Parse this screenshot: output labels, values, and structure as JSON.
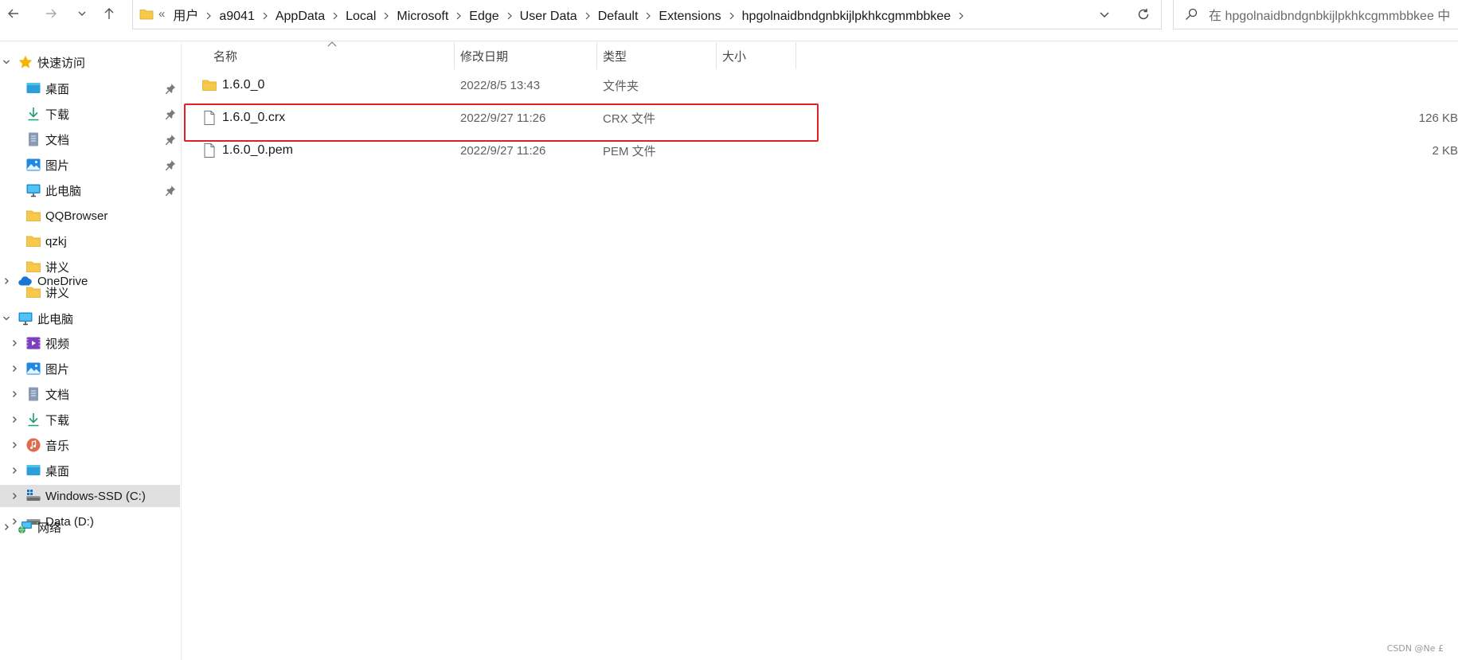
{
  "toolbar": {
    "back_icon": "arrow-left-icon",
    "forward_icon": "arrow-right-icon",
    "recent_icon": "chevron-down-icon",
    "up_icon": "arrow-up-icon"
  },
  "address": {
    "overflow": "«",
    "crumbs": [
      "用户",
      "a9041",
      "AppData",
      "Local",
      "Microsoft",
      "Edge",
      "User Data",
      "Default",
      "Extensions",
      "hpgolnaidbndgnbkijlpkhkcgmmbbkee"
    ]
  },
  "search": {
    "placeholder": "在 hpgolnaidbndgnbkijlpkhkcgmmbbkee 中"
  },
  "sidebar": {
    "quick_access": "快速访问",
    "quick_items": [
      {
        "label": "桌面",
        "icon": "desktop-icon",
        "pinned": true
      },
      {
        "label": "下载",
        "icon": "download-icon",
        "pinned": true
      },
      {
        "label": "文档",
        "icon": "document-icon",
        "pinned": true
      },
      {
        "label": "图片",
        "icon": "pictures-icon",
        "pinned": true
      },
      {
        "label": "此电脑",
        "icon": "computer-icon",
        "pinned": true
      },
      {
        "label": "QQBrowser",
        "icon": "folder-icon",
        "pinned": false
      },
      {
        "label": "qzkj",
        "icon": "folder-icon",
        "pinned": false
      },
      {
        "label": "讲义",
        "icon": "folder-icon",
        "pinned": false
      },
      {
        "label": "讲义",
        "icon": "folder-icon",
        "pinned": false
      }
    ],
    "onedrive": "OneDrive",
    "this_pc": "此电脑",
    "pc_items": [
      {
        "label": "视频",
        "icon": "video-icon"
      },
      {
        "label": "图片",
        "icon": "pictures-icon"
      },
      {
        "label": "文档",
        "icon": "document-icon"
      },
      {
        "label": "下载",
        "icon": "download-icon"
      },
      {
        "label": "音乐",
        "icon": "music-icon"
      },
      {
        "label": "桌面",
        "icon": "desktop-icon"
      },
      {
        "label": "Windows-SSD (C:)",
        "icon": "windows-drive-icon",
        "selected": true
      },
      {
        "label": "Data (D:)",
        "icon": "drive-icon"
      }
    ],
    "network": "网络"
  },
  "columns": {
    "name": "名称",
    "date": "修改日期",
    "type": "类型",
    "size": "大小"
  },
  "files": [
    {
      "name": "1.6.0_0",
      "date": "2022/8/5 13:43",
      "type": "文件夹",
      "size": "",
      "icon": "folder-icon"
    },
    {
      "name": "1.6.0_0.crx",
      "date": "2022/9/27 11:26",
      "type": "CRX 文件",
      "size": "126 KB",
      "icon": "file-icon",
      "highlighted": true
    },
    {
      "name": "1.6.0_0.pem",
      "date": "2022/9/27 11:26",
      "type": "PEM 文件",
      "size": "2 KB",
      "icon": "file-icon"
    }
  ],
  "watermark": "CSDN @Ne £",
  "colors": {
    "highlight_border": "#e21e26",
    "selected_bg": "#e0e0e0",
    "folder": "#f8c84a"
  }
}
